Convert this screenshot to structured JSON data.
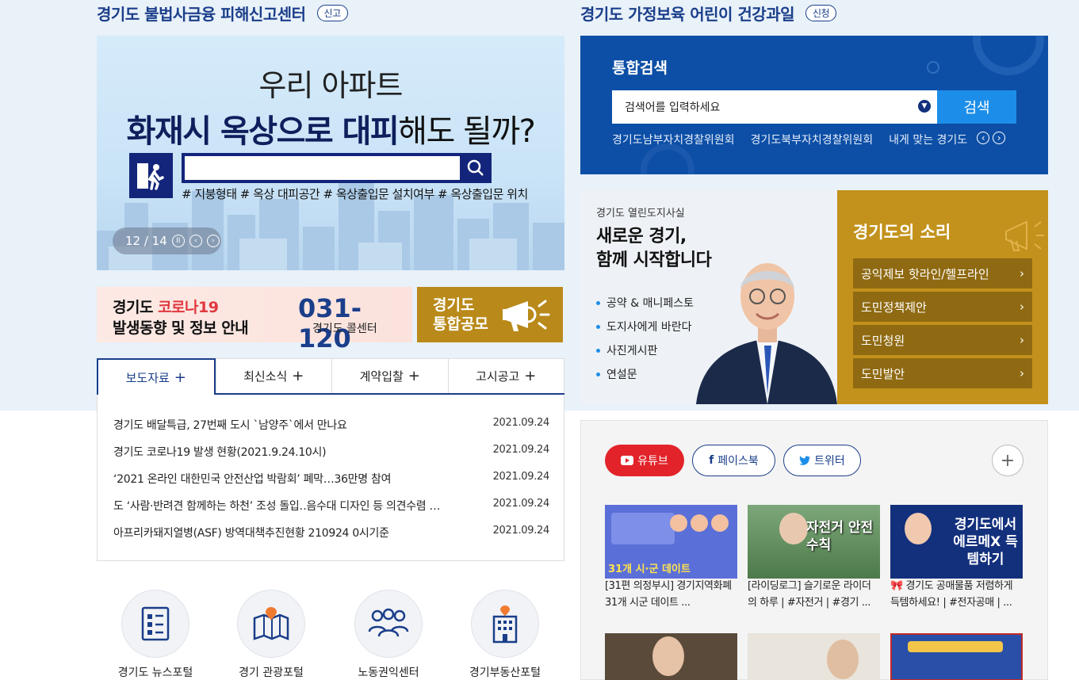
{
  "left": {
    "section_title": "경기도 불법사금융 피해신고센터",
    "section_badge": "신고",
    "banner": {
      "line1": "우리 아파트",
      "line2_bold": "화재시 옥상으로 대피",
      "line2_rest": "해도 될까?",
      "tags": "# 지붕형태 # 옥상 대피공간 # 옥상출입문 설치여부 # 옥상출입문 위치",
      "pager": "12 / 14"
    },
    "corona": {
      "prefix": "경기도 ",
      "highlight": "코로나19",
      "line2": "발생동향 및 정보 안내",
      "phone": "031-120",
      "callcenter": "경기도 콜센터"
    },
    "gongmo": {
      "line1": "경기도",
      "line2": "통합공모"
    },
    "tabs": [
      {
        "label": "보도자료",
        "plus": "+"
      },
      {
        "label": "최신소식",
        "plus": "+"
      },
      {
        "label": "계약입찰",
        "plus": "+"
      },
      {
        "label": "고시공고",
        "plus": "+"
      }
    ],
    "news": [
      {
        "title": "경기도 배달특급, 27번째 도시 `남양주`에서 만나요",
        "date": "2021.09.24"
      },
      {
        "title": "경기도 코로나19 발생 현황(2021.9.24.10시)",
        "date": "2021.09.24"
      },
      {
        "title": "‘2021 온라인 대한민국 안전산업 박람회’ 폐막…36만명 참여",
        "date": "2021.09.24"
      },
      {
        "title": "도 ‘사람·반려견 함께하는 하천’ 조성 돌입‥음수대 디자인 등 의견수렴 …",
        "date": "2021.09.24"
      },
      {
        "title": "아프리카돼지열병(ASF) 방역대책추진현황 210924 0시기준",
        "date": "2021.09.24"
      }
    ],
    "portals": [
      {
        "label": "경기도 뉴스포털"
      },
      {
        "label": "경기 관광포털"
      },
      {
        "label": "노동권익센터"
      },
      {
        "label": "경기부동산포털"
      }
    ]
  },
  "right": {
    "section_title": "경기도 가정보육 어린이 건강과일",
    "section_badge": "신청",
    "search": {
      "title": "통합검색",
      "placeholder": "검색어를 입력하세요",
      "button": "검색",
      "links": [
        "경기도남부자치경찰위원회",
        "경기도북부자치경찰위원회",
        "내게 맞는 경기도"
      ]
    },
    "governor": {
      "subtitle": "경기도 열린도지사실",
      "headline1": "새로운 경기,",
      "headline2": "함께 시작합니다",
      "items": [
        "공약 & 매니페스토",
        "도지사에게 바란다",
        "사진게시판",
        "연설문"
      ]
    },
    "voice": {
      "title": "경기도의 소리",
      "items": [
        "공익제보 핫라인/헬프라인",
        "도민정책제안",
        "도민청원",
        "도민발안"
      ]
    },
    "sns": {
      "buttons": [
        "유튜브",
        "페이스북",
        "트위터"
      ],
      "more": "+",
      "videos": [
        {
          "thumb_text": "31개 시·군 데이트",
          "caption1": "[31편 의정부시] 경기지역화폐",
          "caption2": "31개 시군 데이트 ..."
        },
        {
          "thumb_text": "자전거 안전수칙",
          "caption1": "[라이딩로그] 슬기로운 라이더",
          "caption2": "의 하루 | #자전거 | #경기 ..."
        },
        {
          "thumb_text": "경기도에서 에르메X 득템하기",
          "caption1": "🎀 경기도 공매물품 저렴하게",
          "caption2": "득템하세요! | #전자공매 | ..."
        }
      ]
    }
  },
  "colors": {
    "navy": "#1a3e8a",
    "gold": "#c3921c",
    "search_blue": "#0d4fa6",
    "youtube_red": "#e2232a"
  }
}
